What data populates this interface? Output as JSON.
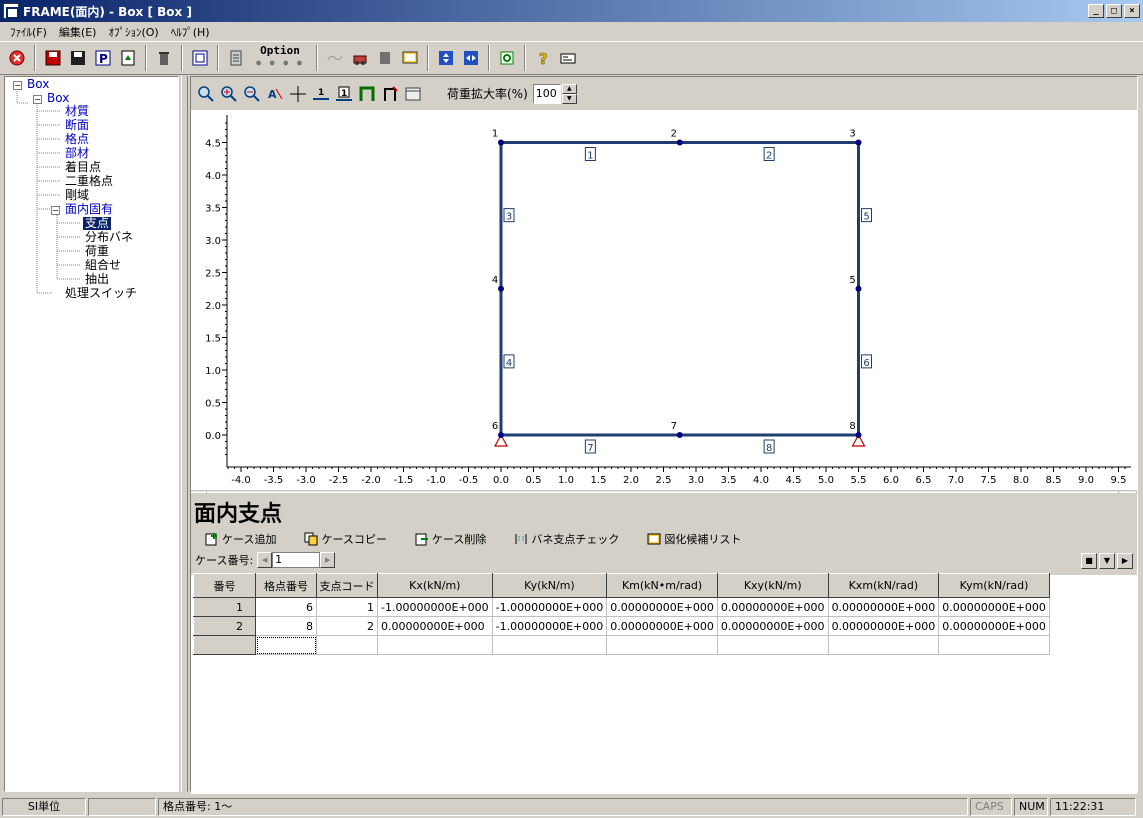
{
  "window": {
    "title": "FRAME(面内) - Box [ Box ]"
  },
  "menu": [
    "ﾌｧｲﾙ(F)",
    "編集(E)",
    "ｵﾌﾟｼｮﾝ(O)",
    "ﾍﾙﾌﾟ(H)"
  ],
  "toolbar": {
    "option_label": "Option",
    "icons": [
      "stop-icon",
      "save-red-icon",
      "save-icon",
      "print-p-icon",
      "export-icon",
      "trash-icon",
      "calc-icon",
      "list-icon",
      "wave-icon",
      "machine-icon",
      "block-icon",
      "monitor-icon",
      "vertical-fit-icon",
      "horizontal-fit-icon",
      "refresh-icon",
      "help-icon",
      "info-icon"
    ]
  },
  "tree": {
    "root": "Box",
    "child": "Box",
    "items": [
      "材質",
      "断面",
      "格点",
      "部材",
      "着目点",
      "二重格点",
      "剛域",
      "面内固有"
    ],
    "sub_items": [
      "支点",
      "分布バネ",
      "荷重",
      "組合せ",
      "抽出"
    ],
    "last": "処理スイッチ"
  },
  "view": {
    "zoom_label": "荷重拡大率(%)",
    "zoom_value": "100"
  },
  "chart_data": {
    "type": "diagram",
    "x_ticks": [
      "-4.0",
      "-3.5",
      "-3.0",
      "-2.5",
      "-2.0",
      "-1.5",
      "-1.0",
      "-0.5",
      "0.0",
      "0.5",
      "1.0",
      "1.5",
      "2.0",
      "2.5",
      "3.0",
      "3.5",
      "4.0",
      "4.5",
      "5.0",
      "5.5",
      "6.0",
      "6.5",
      "7.0",
      "7.5",
      "8.0",
      "8.5",
      "9.0",
      "9.5"
    ],
    "y_ticks": [
      "0.0",
      "0.5",
      "1.0",
      "1.5",
      "2.0",
      "2.5",
      "3.0",
      "3.5",
      "4.0",
      "4.5"
    ],
    "xlim": [
      -4.0,
      9.5
    ],
    "ylim": [
      0.0,
      4.5
    ],
    "nodes": [
      {
        "id": "1",
        "x": 0.0,
        "y": 4.5
      },
      {
        "id": "2",
        "x": 2.75,
        "y": 4.5
      },
      {
        "id": "3",
        "x": 5.5,
        "y": 4.5
      },
      {
        "id": "4",
        "x": 0.0,
        "y": 2.25
      },
      {
        "id": "5",
        "x": 5.5,
        "y": 2.25
      },
      {
        "id": "6",
        "x": 0.0,
        "y": 0.0
      },
      {
        "id": "7",
        "x": 2.75,
        "y": 0.0
      },
      {
        "id": "8",
        "x": 5.5,
        "y": 0.0
      }
    ],
    "members": [
      {
        "id": "1",
        "from": "1",
        "to": "2"
      },
      {
        "id": "2",
        "from": "2",
        "to": "3"
      },
      {
        "id": "3",
        "from": "1",
        "to": "4"
      },
      {
        "id": "4",
        "from": "4",
        "to": "6"
      },
      {
        "id": "5",
        "from": "3",
        "to": "5"
      },
      {
        "id": "6",
        "from": "5",
        "to": "8"
      },
      {
        "id": "7",
        "from": "6",
        "to": "7"
      },
      {
        "id": "8",
        "from": "7",
        "to": "8"
      }
    ],
    "supports": [
      "6",
      "8"
    ],
    "colors": {
      "member": "#1f3d6e",
      "node": "#000080",
      "support": "#c00000"
    }
  },
  "panel": {
    "title": "面内支点",
    "buttons": [
      "ケース追加",
      "ケースコピー",
      "ケース削除",
      "バネ支点チェック",
      "図化候補リスト"
    ],
    "case_label": "ケース番号:",
    "case_value": "1"
  },
  "table": {
    "headers": [
      "番号",
      "格点番号",
      "支点コード",
      "Kx(kN/m)",
      "Ky(kN/m)",
      "Km(kN•m/rad)",
      "Kxy(kN/m)",
      "Kxm(kN/rad)",
      "Kym(kN/rad)"
    ],
    "rows": [
      [
        "1",
        "6",
        "1",
        "-1.00000000E+000",
        "-1.00000000E+000",
        "0.00000000E+000",
        "0.00000000E+000",
        "0.00000000E+000",
        "0.00000000E+000"
      ],
      [
        "2",
        "8",
        "2",
        "0.00000000E+000",
        "-1.00000000E+000",
        "0.00000000E+000",
        "0.00000000E+000",
        "0.00000000E+000",
        "0.00000000E+000"
      ]
    ]
  },
  "status": {
    "unit": "SI単位",
    "info": "格点番号: 1〜",
    "caps": "CAPS",
    "num": "NUM",
    "time": "11:22:31"
  }
}
